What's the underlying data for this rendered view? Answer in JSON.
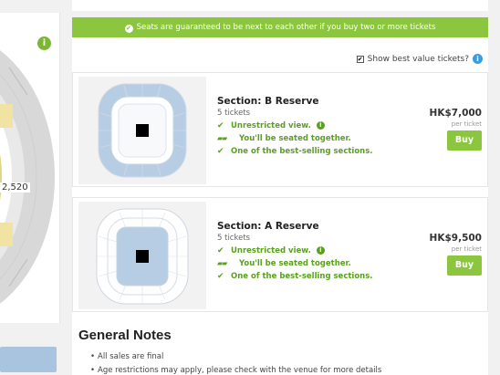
{
  "banner": {
    "text": "Seats are guaranteed to be next to each other if you buy two or more tickets"
  },
  "best_value": {
    "label": "Show best value tickets?",
    "checked": true
  },
  "map": {
    "price_label": "2,520"
  },
  "listings": [
    {
      "section": "Section: B Reserve",
      "tickets": "5 tickets",
      "features": [
        "Unrestricted view.",
        "You'll be seated together.",
        "One of the best-selling sections."
      ],
      "price": "HK$7,000",
      "per_ticket": "per ticket",
      "buy_label": "Buy"
    },
    {
      "section": "Section: A Reserve",
      "tickets": "5 tickets",
      "features": [
        "Unrestricted view.",
        "You'll be seated together.",
        "One of the best-selling sections."
      ],
      "price": "HK$9,500",
      "per_ticket": "per ticket",
      "buy_label": "Buy"
    }
  ],
  "general_notes": {
    "title": "General Notes",
    "items": [
      "All sales are final",
      "Age restrictions may apply, please check with the venue for more details"
    ]
  },
  "colors": {
    "accent_green": "#8cc63f",
    "info_blue": "#3a9be0",
    "section_blue": "#a9c4de"
  }
}
